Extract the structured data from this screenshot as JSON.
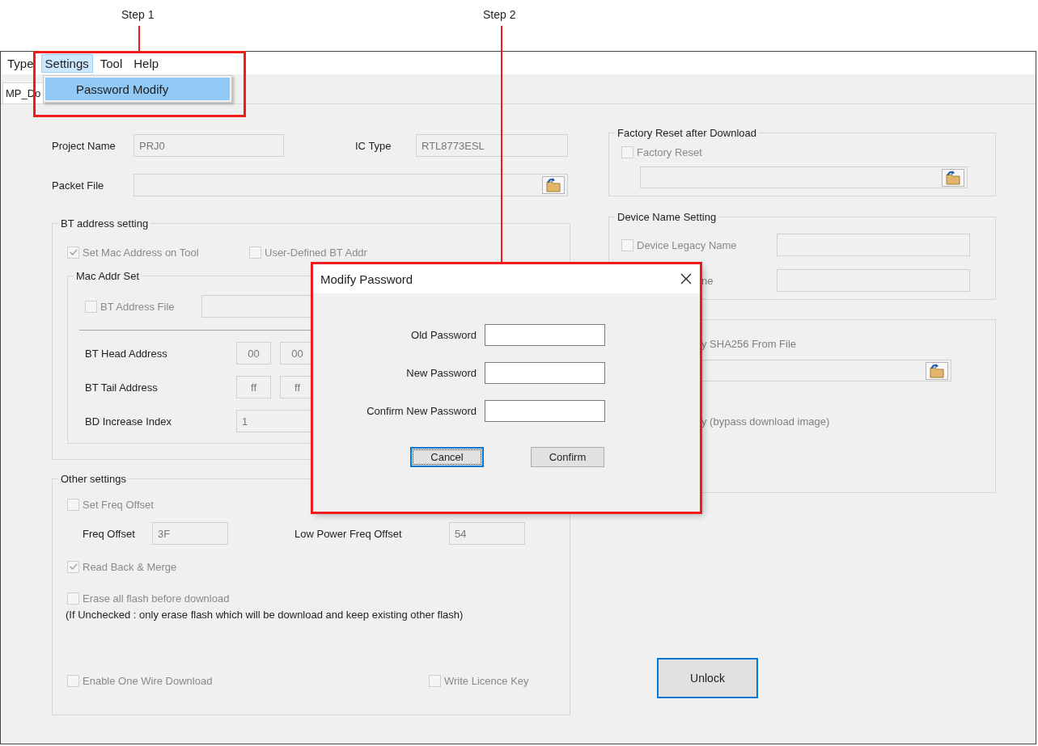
{
  "annotations": [
    {
      "label": "Step 1"
    },
    {
      "label": "Step 2"
    }
  ],
  "menu_bar": [
    {
      "label": "Type",
      "selected": false
    },
    {
      "label": "Settings",
      "selected": true
    },
    {
      "label": "Tool",
      "selected": false
    },
    {
      "label": "Help",
      "selected": false
    }
  ],
  "settings_menu": {
    "items": [
      {
        "label": "Password Modify",
        "selected": true
      }
    ]
  },
  "tabs": [
    {
      "label": "MP_Do",
      "selected": true
    }
  ],
  "project": {
    "project_name_label": "Project Name",
    "project_name": "PRJ0",
    "ic_type_label": "IC Type",
    "ic_type": "RTL8773ESL",
    "packet_file_label": "Packet File"
  },
  "bt_address_setting": {
    "title": "BT address setting",
    "options": [
      {
        "label": "Set Mac Address on Tool",
        "checked": true,
        "disabled": true
      },
      {
        "label": "User-Defined BT Addr",
        "checked": false,
        "disabled": true
      }
    ],
    "mac_addr_set": {
      "title": "Mac Addr Set",
      "address_file": {
        "label": "BT Address File",
        "checked": false,
        "disabled": true
      },
      "rows": [
        {
          "label": "BT Head Address",
          "kind": "bytes",
          "values": [
            "00",
            "00"
          ]
        },
        {
          "label": "BT Tail Address",
          "kind": "bytes",
          "values": [
            "ff",
            "ff"
          ]
        },
        {
          "label": "BD Increase Index",
          "kind": "number",
          "values": [
            "1"
          ]
        }
      ]
    }
  },
  "other_settings": {
    "title": "Other settings",
    "set_freq_offset": {
      "label": "Set Freq Offset",
      "checked": false,
      "disabled": true
    },
    "freq_offset_label": "Freq Offset",
    "freq_offset": "3F",
    "low_power_label": "Low Power Freq Offset",
    "low_power": "54",
    "read_back": {
      "label": "Read Back & Merge",
      "checked": true,
      "disabled": true
    },
    "erase_all": {
      "label": "Erase all flash before download",
      "checked": false,
      "disabled": true
    },
    "note": "(If Unchecked : only erase flash which will be download and keep existing other flash)",
    "one_wire": {
      "label": "Enable One Wire Download",
      "checked": false,
      "disabled": true
    },
    "licence_key": {
      "label": "Write Licence Key",
      "checked": false,
      "disabled": true
    }
  },
  "factory_reset": {
    "title": "Factory Reset after Download",
    "option": {
      "label": "Factory Reset",
      "checked": false,
      "disabled": true
    }
  },
  "device_name": {
    "title": "Device Name Setting",
    "legacy": {
      "label": "Device Legacy Name",
      "checked": false,
      "disabled": true
    },
    "partial_label": "ne"
  },
  "verify_section": {
    "line_1": "y SHA256 From File",
    "line_2": "y (bypass download image)"
  },
  "unlock_button": "Unlock",
  "dialog": {
    "title": "Modify Password",
    "fields": [
      {
        "label": "Old Password"
      },
      {
        "label": "New Password"
      },
      {
        "label": "Confirm New Password"
      }
    ],
    "buttons": [
      {
        "label": "Cancel",
        "focused": true
      },
      {
        "label": "Confirm",
        "focused": false
      }
    ]
  }
}
